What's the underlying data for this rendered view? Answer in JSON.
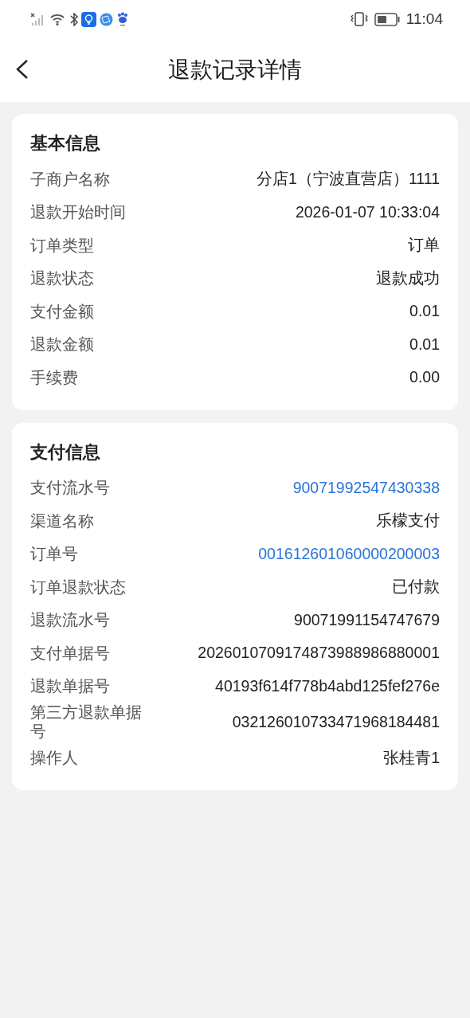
{
  "status_bar": {
    "time": "11:04"
  },
  "header": {
    "title": "退款记录详情"
  },
  "sections": [
    {
      "title": "基本信息",
      "rows": [
        {
          "label": "子商户名称",
          "value": "分店1（宁波直营店）1111",
          "kind": "text"
        },
        {
          "label": "退款开始时间",
          "value": "2026-01-07 10:33:04",
          "kind": "text"
        },
        {
          "label": "订单类型",
          "value": "订单",
          "kind": "text"
        },
        {
          "label": "退款状态",
          "value": "退款成功",
          "kind": "text"
        },
        {
          "label": "支付金额",
          "value": "0.01",
          "kind": "text"
        },
        {
          "label": "退款金额",
          "value": "0.01",
          "kind": "text"
        },
        {
          "label": "手续费",
          "value": "0.00",
          "kind": "text"
        }
      ]
    },
    {
      "title": "支付信息",
      "rows": [
        {
          "label": "支付流水号",
          "value": "90071992547430338",
          "kind": "link"
        },
        {
          "label": "渠道名称",
          "value": "乐檬支付",
          "kind": "text"
        },
        {
          "label": "订单号",
          "value": "001612601060000200003",
          "kind": "link"
        },
        {
          "label": "订单退款状态",
          "value": "已付款",
          "kind": "text"
        },
        {
          "label": "退款流水号",
          "value": "90071991154747679",
          "kind": "text"
        },
        {
          "label": "支付单据号",
          "value": "2026010709174873988986880001",
          "kind": "text"
        },
        {
          "label": "退款单据号",
          "value": "40193f614f778b4abd125fef276e",
          "kind": "text"
        },
        {
          "label": "第三方退款单据号",
          "value": "032126010733471968184481",
          "kind": "text"
        },
        {
          "label": "操作人",
          "value": "张桂青1",
          "kind": "text"
        }
      ]
    }
  ]
}
